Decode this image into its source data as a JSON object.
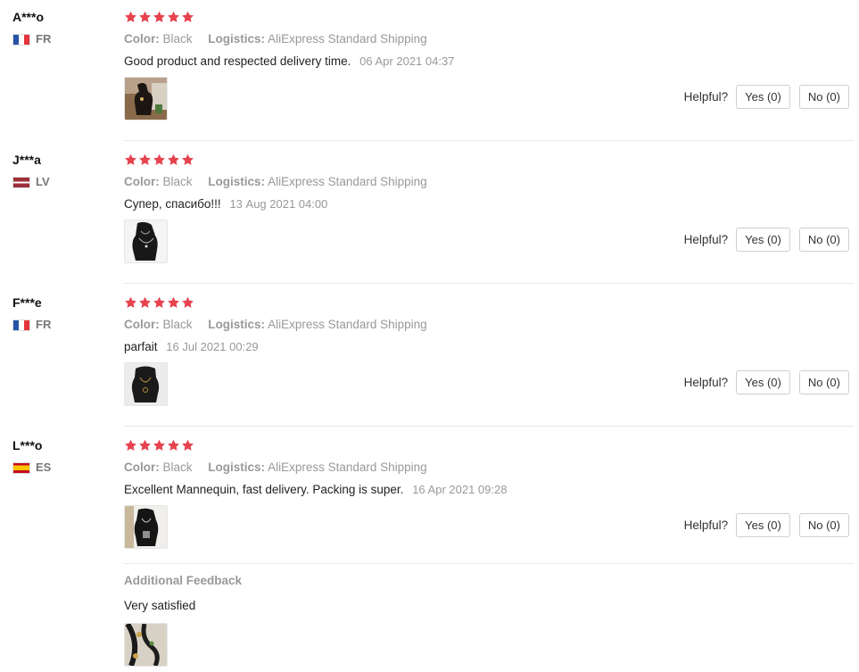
{
  "labels": {
    "color_key": "Color:",
    "logistics_key": "Logistics:",
    "helpful": "Helpful?",
    "yes": "Yes (0)",
    "no": "No (0)"
  },
  "colors": {
    "star": "#e6434f"
  },
  "reviews": [
    {
      "user": "A***o",
      "country": "FR",
      "flag": "france-flag-icon",
      "rating": 5,
      "color": "Black",
      "logistics": "AliExpress Standard Shipping",
      "text": "Good product and respected delivery time.",
      "date": "06 Apr 2021 04:37",
      "helpful_yes": "Yes (0)",
      "helpful_no": "No (0)"
    },
    {
      "user": "J***a",
      "country": "LV",
      "flag": "latvia-flag-icon",
      "rating": 5,
      "color": "Black",
      "logistics": "AliExpress Standard Shipping",
      "text": "Супер, спасибо!!!",
      "date": "13 Aug 2021 04:00",
      "helpful_yes": "Yes (0)",
      "helpful_no": "No (0)"
    },
    {
      "user": "F***e",
      "country": "FR",
      "flag": "france-flag-icon",
      "rating": 5,
      "color": "Black",
      "logistics": "AliExpress Standard Shipping",
      "text": "parfait",
      "date": "16 Jul 2021 00:29",
      "helpful_yes": "Yes (0)",
      "helpful_no": "No (0)"
    },
    {
      "user": "L***o",
      "country": "ES",
      "flag": "spain-flag-icon",
      "rating": 5,
      "color": "Black",
      "logistics": "AliExpress Standard Shipping",
      "text": "Excellent Mannequin, fast delivery. Packing is super.",
      "date": "16 Apr 2021 09:28",
      "helpful_yes": "Yes (0)",
      "helpful_no": "No (0)",
      "additional_feedback": {
        "title": "Additional Feedback",
        "text": "Very satisfied"
      }
    }
  ]
}
